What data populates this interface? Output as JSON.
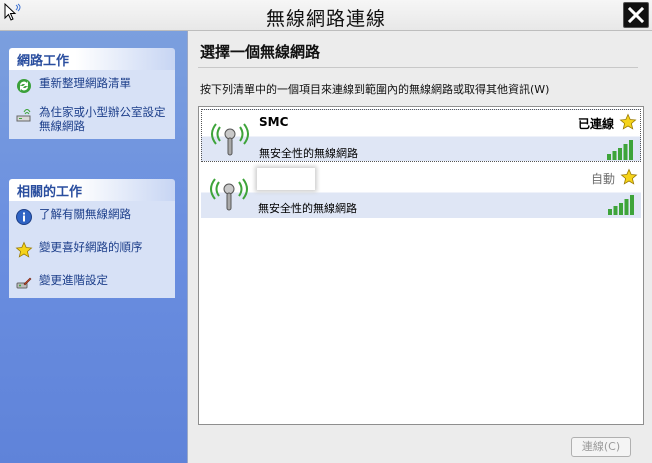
{
  "window": {
    "title": "無線網路連線",
    "icons": {
      "app": "wireless-cursor-icon",
      "close": "close-icon"
    }
  },
  "left_pane": {
    "network_tasks": {
      "header": "網路工作",
      "items": [
        {
          "label": "重新整理網路清單",
          "icon": "refresh-icon"
        },
        {
          "label": "為住家或小型辦公室設定無線網路",
          "icon": "wireless-setup-icon"
        }
      ]
    },
    "related_tasks": {
      "header": "相關的工作",
      "items": [
        {
          "label": "了解有關無線網路",
          "icon": "info-icon"
        },
        {
          "label": "變更喜好網路的順序",
          "icon": "star-icon"
        },
        {
          "label": "變更進階設定",
          "icon": "settings-icon"
        }
      ]
    }
  },
  "main": {
    "title": "選擇一個無線網路",
    "instruction": "按下列清單中的一個項目來連線到範圍內的無線網路或取得其他資訊(W)",
    "networks": [
      {
        "name": "SMC",
        "status": "已連線",
        "security": "無安全性的無線網路",
        "signal_bars": 5,
        "preferred": true,
        "selected": true
      },
      {
        "name": "",
        "status": "自動",
        "security": "無安全性的無線網路",
        "signal_bars": 5,
        "preferred": true,
        "selected": false
      }
    ],
    "connect_button": "連線(C)",
    "connect_enabled": false
  },
  "colors": {
    "pane_gradient_top": "#7b9fde",
    "pane_gradient_bottom": "#5f83d9",
    "task_header_text": "#2a4e9f",
    "signal_green": "#3ea43a",
    "star_yellow": "#f5d31a"
  }
}
